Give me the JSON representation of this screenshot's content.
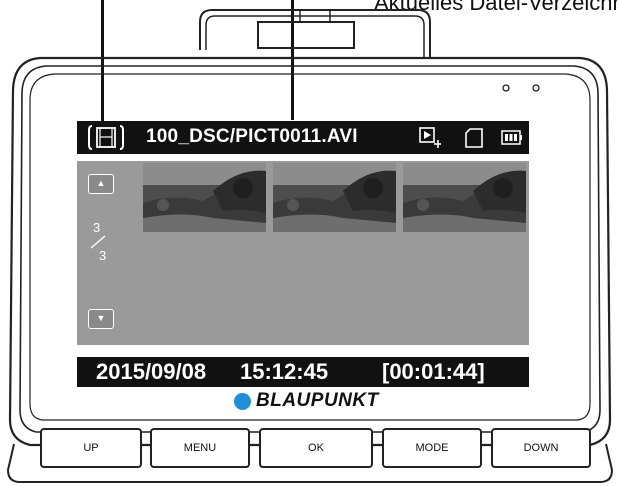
{
  "callout": {
    "label": "Aktuelles Datei-Verzeichnis"
  },
  "screen": {
    "file_path": "100_DSC/PICT0011.AVI",
    "page_current": "3",
    "page_total": "3",
    "date": "2015/09/08",
    "time": "15:12:45",
    "duration": "[00:01:44]",
    "thumbnails": [
      "thumb-1",
      "thumb-2",
      "thumb-3"
    ]
  },
  "brand": {
    "name": "BLAUPUNKT",
    "color": "#1e8fd8"
  },
  "buttons": {
    "up": "UP",
    "menu": "MENU",
    "ok": "OK",
    "mode": "MODE",
    "down": "DOWN"
  },
  "icons": {
    "file_type": "video-film-icon",
    "playback": "playback-mode-icon",
    "sdcard": "sd-card-icon",
    "battery": "battery-icon",
    "nav_up": "chevron-up-icon",
    "nav_down": "chevron-down-icon"
  }
}
